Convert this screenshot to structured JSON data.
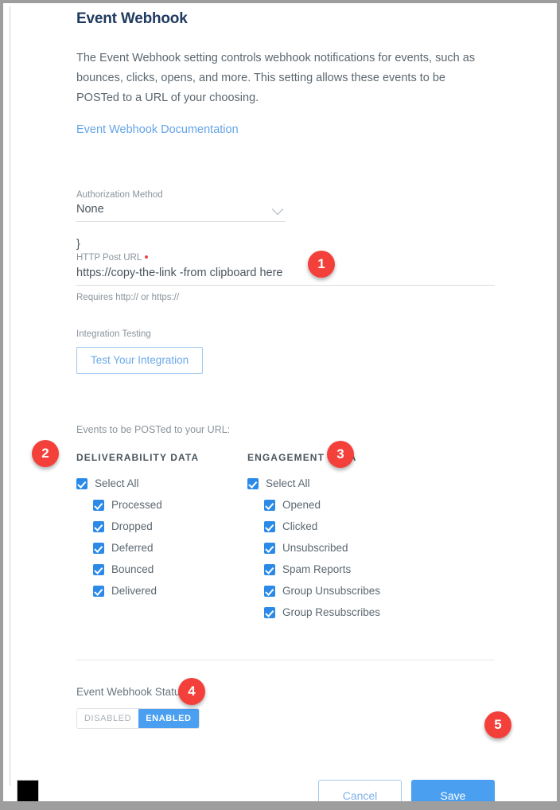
{
  "header": {
    "title": "Event Webhook",
    "description": "The Event Webhook setting controls webhook notifications for events, such as bounces, clicks, opens, and more. This setting allows these events to be POSTed to a URL of your choosing.",
    "doc_link": "Event Webhook Documentation"
  },
  "auth": {
    "label": "Authorization Method",
    "value": "None",
    "chevron_icon": "chevron-down-icon"
  },
  "stray_text": "}",
  "url": {
    "label": "HTTP Post URL",
    "required": true,
    "value": "https://copy-the-link -from clipboard here",
    "placeholder": "https://",
    "help": "Requires http:// or https://"
  },
  "integration": {
    "label": "Integration Testing",
    "button": "Test Your Integration"
  },
  "events": {
    "intro": "Events to be POSTed to your URL:",
    "columns": [
      {
        "heading": "DELIVERABILITY DATA",
        "select_all": {
          "label": "Select All",
          "checked": true
        },
        "items": [
          {
            "label": "Processed",
            "checked": true
          },
          {
            "label": "Dropped",
            "checked": true
          },
          {
            "label": "Deferred",
            "checked": true
          },
          {
            "label": "Bounced",
            "checked": true
          },
          {
            "label": "Delivered",
            "checked": true
          }
        ]
      },
      {
        "heading": "ENGAGEMENT DATA",
        "select_all": {
          "label": "Select All",
          "checked": true
        },
        "items": [
          {
            "label": "Opened",
            "checked": true
          },
          {
            "label": "Clicked",
            "checked": true
          },
          {
            "label": "Unsubscribed",
            "checked": true
          },
          {
            "label": "Spam Reports",
            "checked": true
          },
          {
            "label": "Group Unsubscribes",
            "checked": true
          },
          {
            "label": "Group Resubscribes",
            "checked": true
          }
        ]
      }
    ]
  },
  "status": {
    "label": "Event Webhook Status",
    "info_icon": "info-icon",
    "info_glyph": "i",
    "disabled_label": "DISABLED",
    "enabled_label": "ENABLED",
    "selected": "ENABLED"
  },
  "footer": {
    "cancel_label": "Cancel",
    "save_label": "Save"
  },
  "annotations": [
    {
      "number": "1"
    },
    {
      "number": "2"
    },
    {
      "number": "3"
    },
    {
      "number": "4"
    },
    {
      "number": "5"
    }
  ],
  "colors": {
    "accent_blue": "#4a9ff0",
    "checkbox_blue": "#2b8ae8",
    "link_blue": "#63a4e8",
    "badge_red": "#f4403a",
    "title_navy": "#1f3a5f",
    "body_gray": "#5b6770",
    "required_red": "#e8453c"
  }
}
